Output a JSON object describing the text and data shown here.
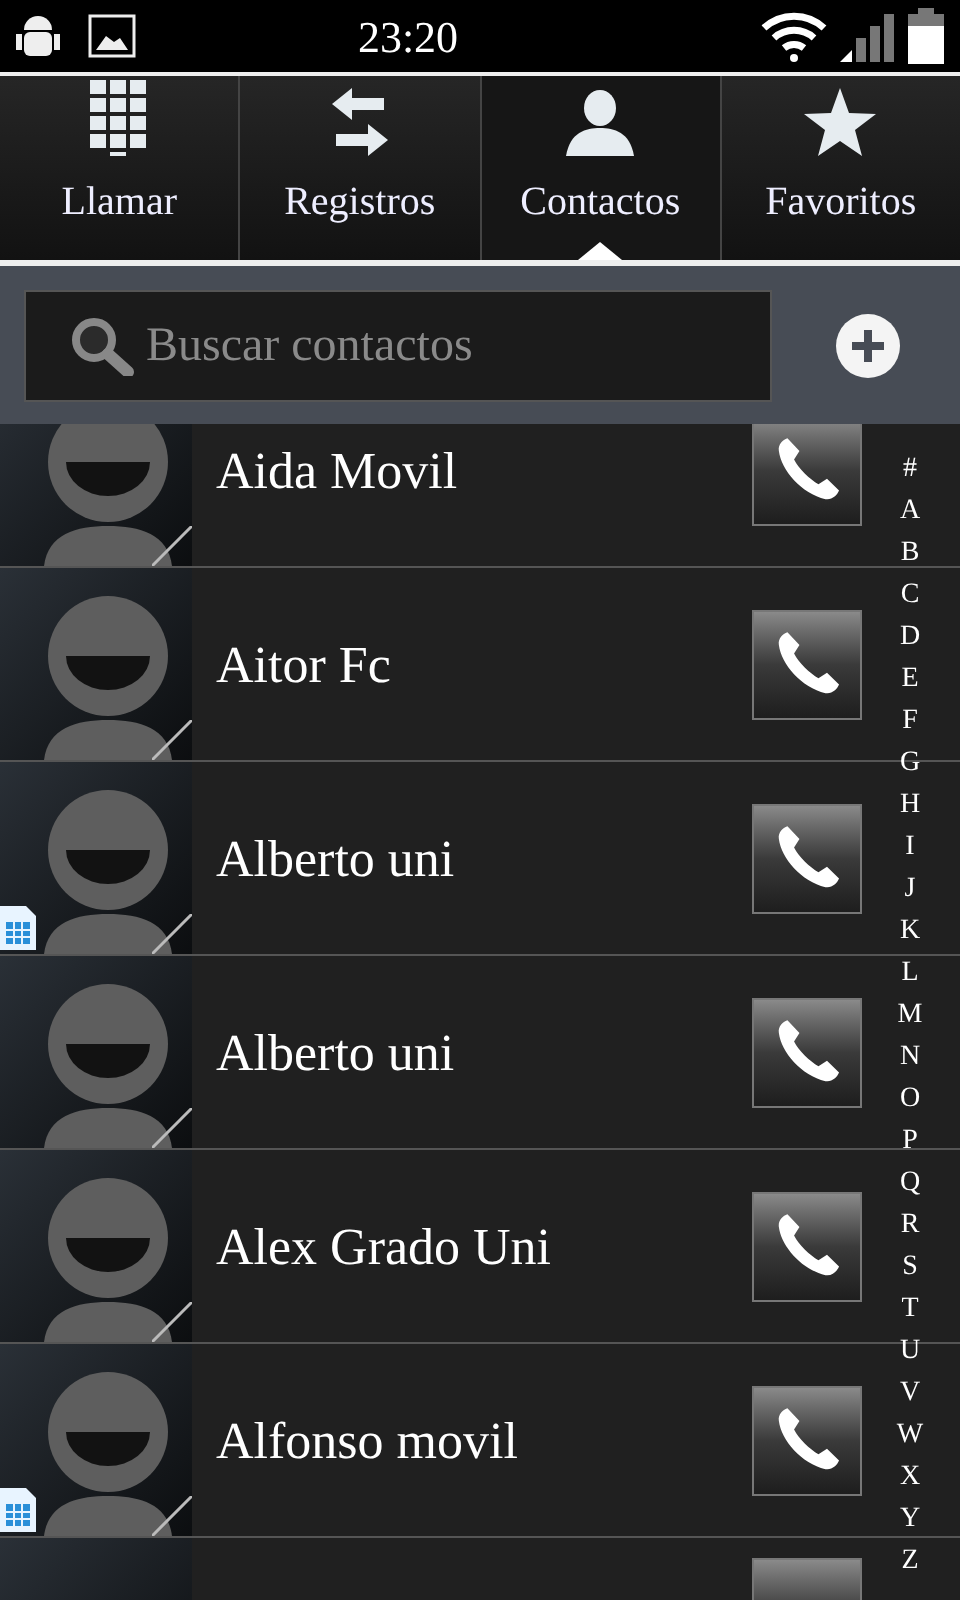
{
  "status_bar": {
    "time": "23:20"
  },
  "tabs": [
    {
      "label": "Llamar",
      "selected": false,
      "kind": "dialpad"
    },
    {
      "label": "Registros",
      "selected": false,
      "kind": "arrows"
    },
    {
      "label": "Contactos",
      "selected": true,
      "kind": "person"
    },
    {
      "label": "Favoritos",
      "selected": false,
      "kind": "star"
    }
  ],
  "search": {
    "placeholder": "Buscar contactos"
  },
  "contacts": [
    {
      "name": "Aida Movil",
      "sim": false
    },
    {
      "name": "Aitor Fc",
      "sim": false
    },
    {
      "name": "Alberto uni",
      "sim": true
    },
    {
      "name": "Alberto uni",
      "sim": false
    },
    {
      "name": "Alex Grado Uni",
      "sim": false
    },
    {
      "name": "Alfonso movil",
      "sim": true
    }
  ],
  "index": [
    "#",
    "A",
    "B",
    "C",
    "D",
    "E",
    "F",
    "G",
    "H",
    "I",
    "J",
    "K",
    "L",
    "M",
    "N",
    "O",
    "P",
    "Q",
    "R",
    "S",
    "T",
    "U",
    "V",
    "W",
    "X",
    "Y",
    "Z"
  ]
}
